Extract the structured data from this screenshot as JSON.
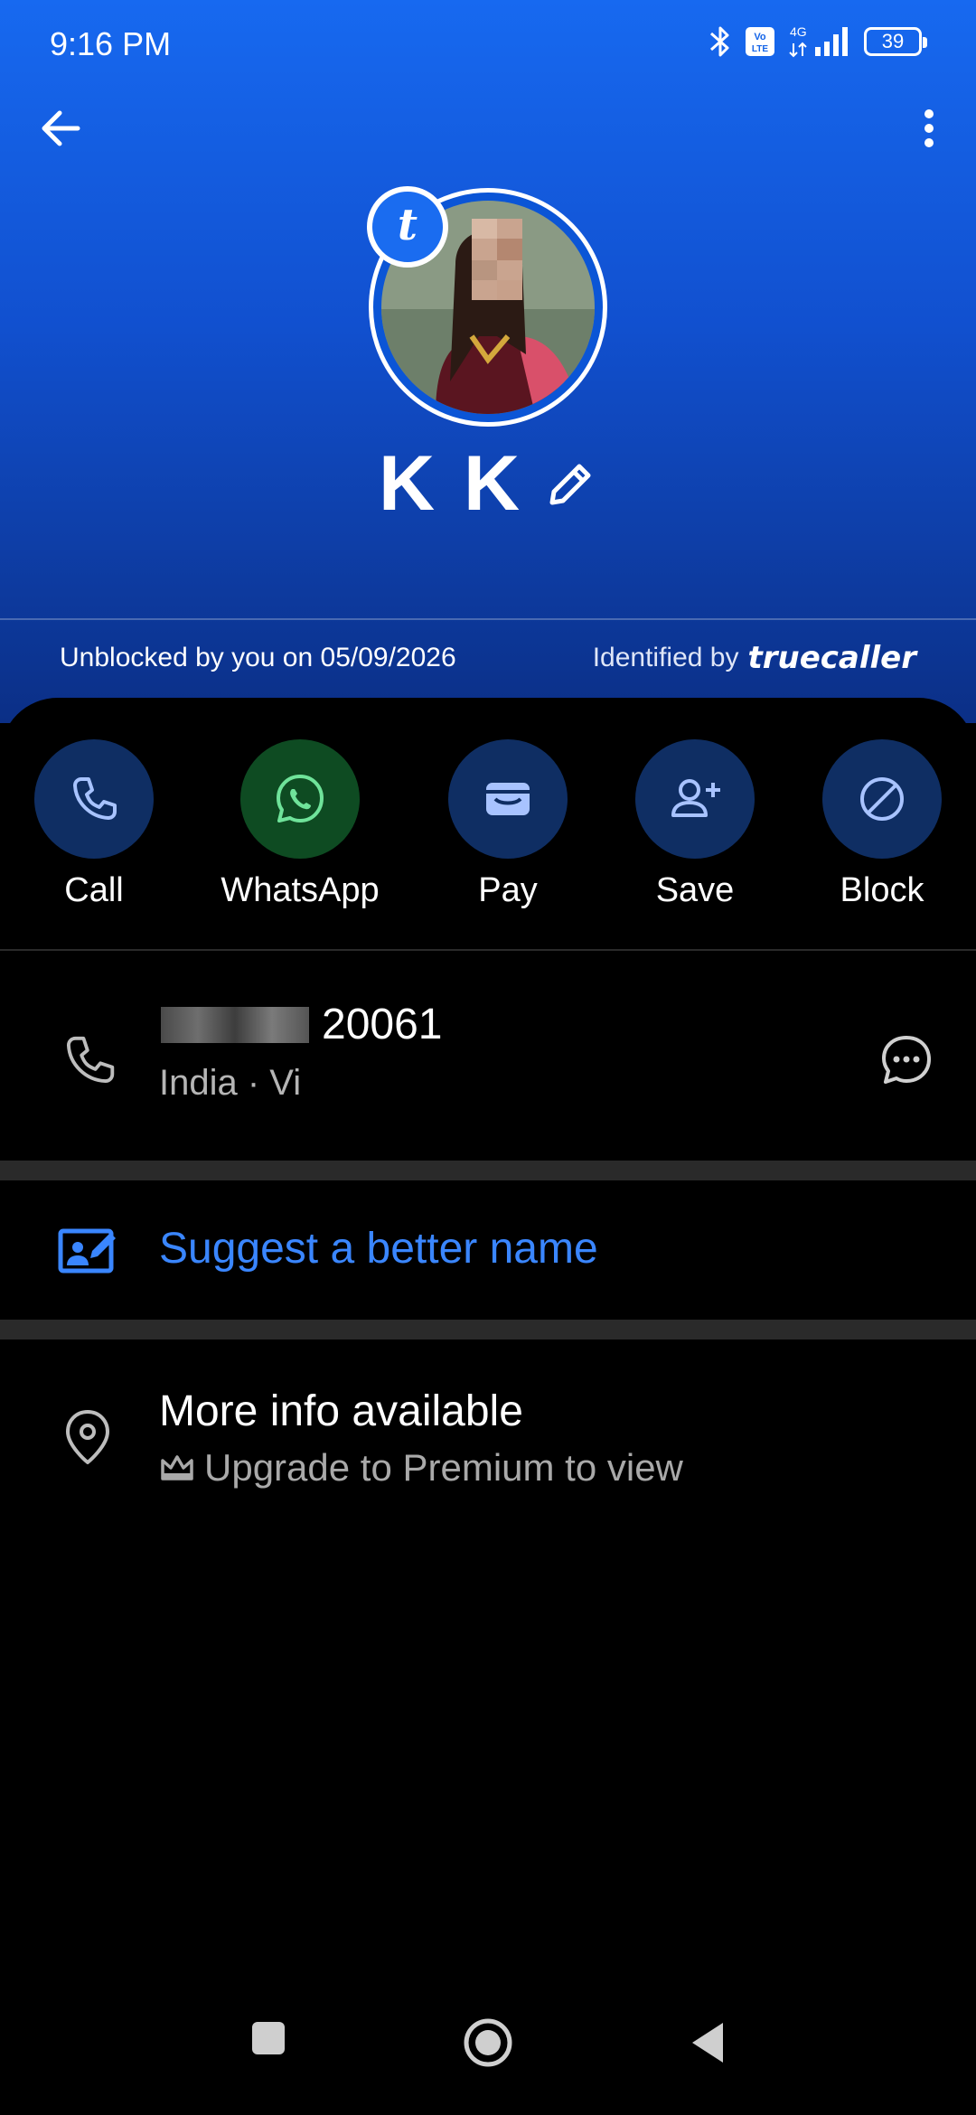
{
  "status_bar": {
    "time": "9:16 PM",
    "network": "4G",
    "volte": "Vo LTE",
    "battery": "39"
  },
  "contact": {
    "name": "K K",
    "badge_letter": "t"
  },
  "banner": {
    "unblocked_text": "Unblocked by you on 05/09/2026",
    "identified_text": "Identified by",
    "brand": "truecaller"
  },
  "actions": [
    {
      "label": "Call",
      "icon": "phone-icon"
    },
    {
      "label": "WhatsApp",
      "icon": "whatsapp-icon"
    },
    {
      "label": "Pay",
      "icon": "wallet-icon"
    },
    {
      "label": "Save",
      "icon": "add-contact-icon"
    },
    {
      "label": "Block",
      "icon": "block-icon"
    }
  ],
  "phone": {
    "number_suffix": "20061",
    "carrier": "India · Vi"
  },
  "suggest": {
    "label": "Suggest a better name"
  },
  "more_info": {
    "title": "More info available",
    "subtitle": "Upgrade to Premium to view"
  },
  "colors": {
    "header_blue": "#1769f0",
    "action_circle": "#0f2e63",
    "whatsapp_circle": "#0e4b22",
    "link_blue": "#3a86ff"
  }
}
